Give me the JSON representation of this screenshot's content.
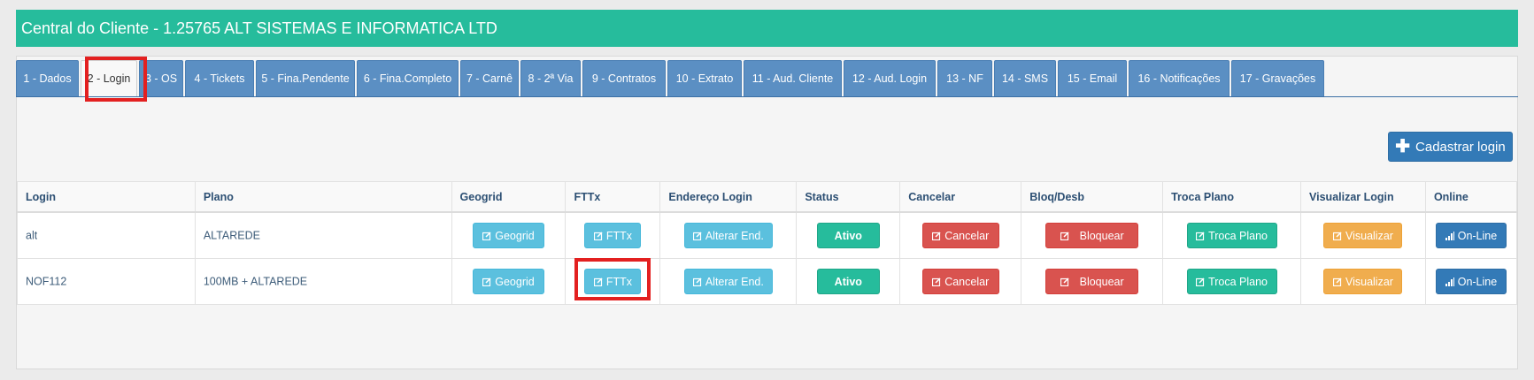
{
  "header": {
    "title": "Central do Cliente - 1.25765 ALT SISTEMAS E INFORMATICA LTD"
  },
  "tabs": [
    {
      "label": "1 - Dados"
    },
    {
      "label": "2 - Login"
    },
    {
      "label": "3 - OS"
    },
    {
      "label": "4 - Tickets"
    },
    {
      "label": "5 - Fina.Pendente"
    },
    {
      "label": "6 - Fina.Completo"
    },
    {
      "label": "7 - Carnê"
    },
    {
      "label": "8 - 2ª Via"
    },
    {
      "label": "9 - Contratos"
    },
    {
      "label": "10 - Extrato"
    },
    {
      "label": "11 - Aud. Cliente"
    },
    {
      "label": "12 - Aud. Login"
    },
    {
      "label": "13 - NF"
    },
    {
      "label": "14 - SMS"
    },
    {
      "label": "15 - Email"
    },
    {
      "label": "16 - Notificações"
    },
    {
      "label": "17 - Gravações"
    }
  ],
  "active_tab": "2 - Login",
  "actions": {
    "cadastrar_login": "Cadastrar login",
    "cadastrar_icon": "plus-icon"
  },
  "table": {
    "columns": [
      "Login",
      "Plano",
      "Geogrid",
      "FTTx",
      "Endereço Login",
      "Status",
      "Cancelar",
      "Bloq/Desb",
      "Troca Plano",
      "Visualizar Login",
      "Online"
    ],
    "rows": [
      {
        "login": "alt",
        "plano": "ALTAREDE",
        "geogrid": "Geogrid",
        "fttx": "FTTx",
        "endereco": "Alterar End.",
        "status": "Ativo",
        "cancelar": "Cancelar",
        "bloq": "Bloquear",
        "troca": "Troca Plano",
        "visualizar": "Visualizar",
        "online": "On-Line"
      },
      {
        "login": "NOF112",
        "plano": "100MB + ALTAREDE",
        "geogrid": "Geogrid",
        "fttx": "FTTx",
        "endereco": "Alterar End.",
        "status": "Ativo",
        "cancelar": "Cancelar",
        "bloq": "Bloquear",
        "troca": "Troca Plano",
        "visualizar": "Visualizar",
        "online": "On-Line"
      }
    ]
  },
  "colors": {
    "header_bg": "#26bc9c",
    "tab_bg": "#5b8fc3",
    "info": "#5bc0de",
    "success": "#26bc9c",
    "danger": "#d9534f",
    "warning": "#f0ad4e",
    "primary": "#337ab7",
    "highlight": "#e32020"
  }
}
